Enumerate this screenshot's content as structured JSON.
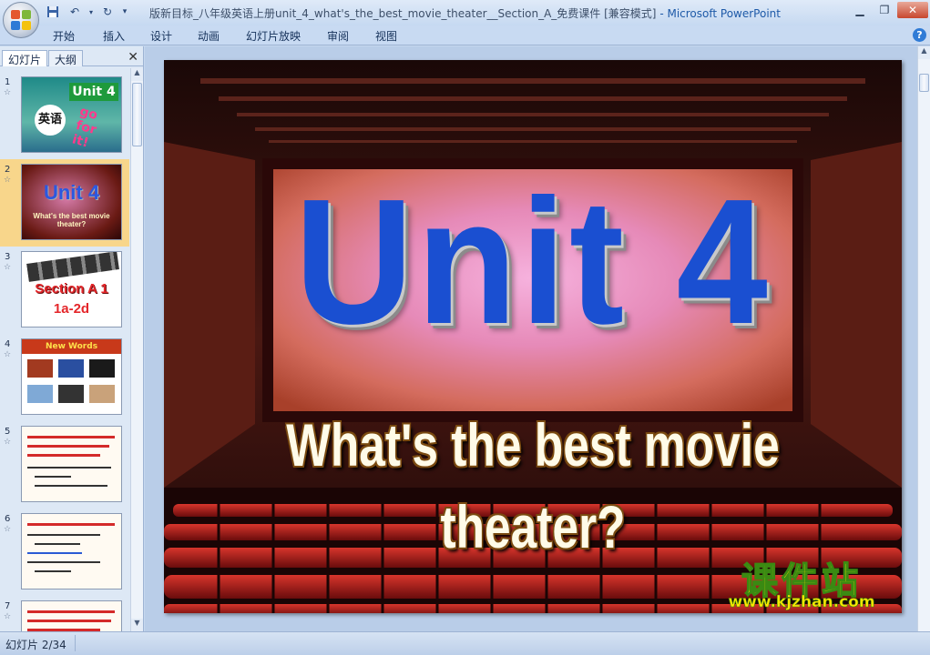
{
  "window": {
    "title": "版新目标_八年级英语上册unit_4_what's_the_best_movie_theater__Section_A_免费课件 [兼容模式]",
    "app_name": "Microsoft PowerPoint",
    "separator": " - "
  },
  "ribbon": {
    "tabs": [
      "开始",
      "插入",
      "设计",
      "动画",
      "幻灯片放映",
      "审阅",
      "视图"
    ]
  },
  "left_pane": {
    "tabs": [
      "幻灯片",
      "大纲"
    ],
    "close_label": "✕",
    "slides": [
      {
        "num": "1",
        "title": "Unit 4",
        "subtitle": "英语"
      },
      {
        "num": "2",
        "title": "Unit 4",
        "subtitle": "What's the best movie theater?"
      },
      {
        "num": "3",
        "title": "Section A 1",
        "subtitle": "1a-2d"
      },
      {
        "num": "4",
        "title": "New Words",
        "subtitle": ""
      },
      {
        "num": "5",
        "title": "",
        "subtitle": ""
      },
      {
        "num": "6",
        "title": "",
        "subtitle": ""
      },
      {
        "num": "7",
        "title": "",
        "subtitle": ""
      }
    ]
  },
  "slide": {
    "unit": "Unit 4",
    "subtitle": "What's the best movie theater?",
    "watermark_cn": "课件站",
    "watermark_url": "www.kjzhan.com"
  },
  "status": {
    "slide_info": "幻灯片 2/34"
  },
  "colors": {
    "unit_blue": "#1a4fd1",
    "selected_thumb": "#f8d68b",
    "watermark_yellow": "#ffe600"
  }
}
